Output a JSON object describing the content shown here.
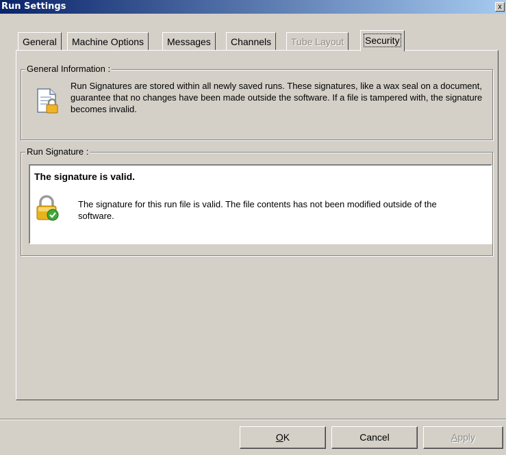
{
  "window": {
    "title": "Run Settings",
    "close_label": "x"
  },
  "tabs": [
    {
      "label": "General",
      "state": "normal"
    },
    {
      "label": "Machine Options",
      "state": "normal"
    },
    {
      "label": "Messages",
      "state": "normal"
    },
    {
      "label": "Channels",
      "state": "normal"
    },
    {
      "label": "Tube Layout",
      "state": "disabled"
    },
    {
      "label": "Security",
      "state": "active"
    }
  ],
  "general_info": {
    "title": "General Information :",
    "text": "Run Signatures are stored within all newly saved runs. These signatures, like a wax seal on a document, guarantee that no changes have been made outside the software. If a file is tampered with, the signature becomes invalid.",
    "icon": "document-lock-icon"
  },
  "run_signature": {
    "title": "Run Signature :",
    "heading": "The signature is valid.",
    "text": "The signature for this run file is valid. The file contents has not been modified outside of the software.",
    "icon": "padlock-check-icon"
  },
  "buttons": {
    "ok": "OK",
    "cancel": "Cancel",
    "apply": "Apply"
  },
  "colors": {
    "title_bar": "#0a246a",
    "face": "#d4d0c8",
    "check_green": "#3fa93a",
    "lock_gold": "#e0b020"
  }
}
